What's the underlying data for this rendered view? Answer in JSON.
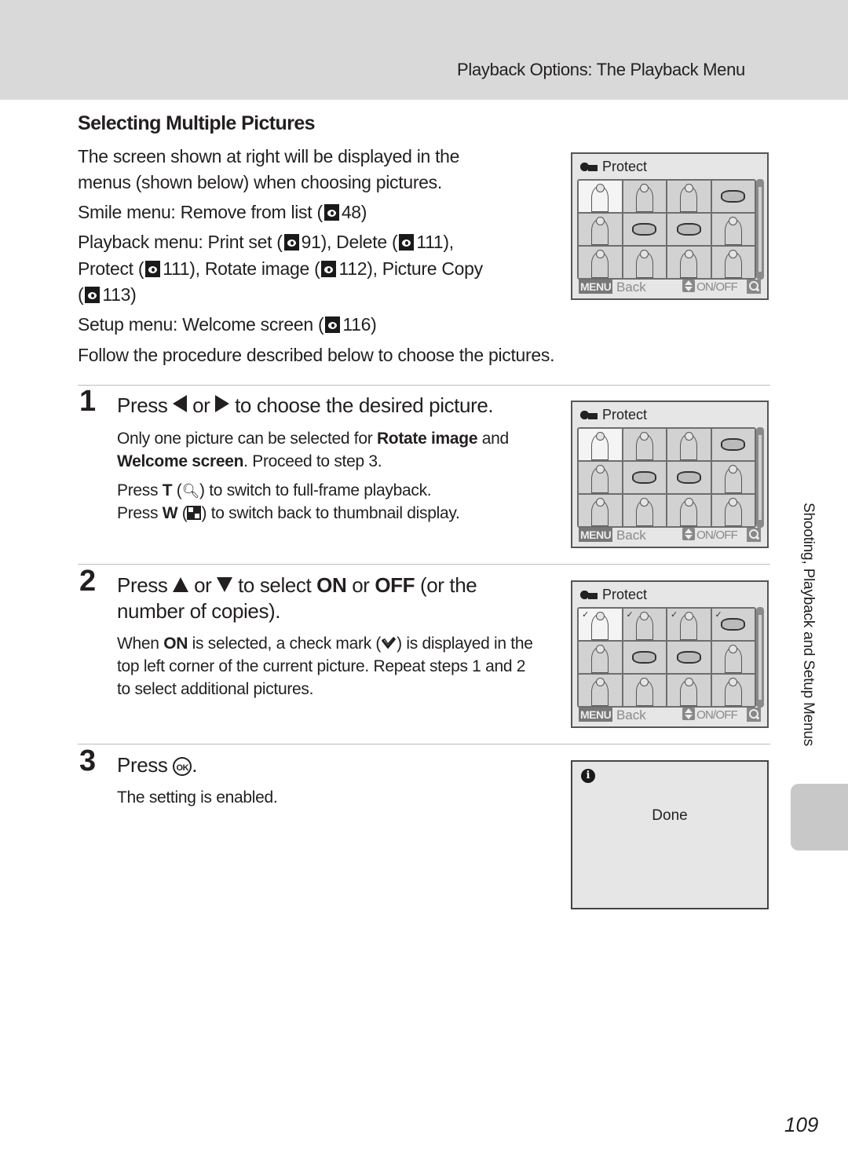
{
  "header": {
    "title": "Playback Options: The Playback Menu"
  },
  "section": {
    "title": "Selecting Multiple Pictures"
  },
  "intro": {
    "line1": "The screen shown at right will be displayed in the",
    "line2": "menus (shown below) when choosing pictures.",
    "smile_prefix": "Smile menu: Remove from list (",
    "smile_ref": "48",
    "smile_suffix": ")",
    "playback_prefix": "Playback menu: Print set (",
    "print_ref": "91",
    "delete_label": "), Delete (",
    "delete_ref": "111",
    "delete_suffix": "),",
    "protect_label": "Protect (",
    "protect_ref": "111",
    "rotate_label": "), Rotate image (",
    "rotate_ref": "112",
    "copy_label": "), Picture Copy",
    "copy_open": "(",
    "copy_ref": "113",
    "copy_suffix": ")",
    "setup_prefix": "Setup menu: Welcome screen (",
    "setup_ref": "116",
    "setup_suffix": ")",
    "follow": "Follow the procedure described below to choose the pictures."
  },
  "steps": [
    {
      "number": "1",
      "head_prefix": "Press",
      "head_or": "or",
      "head_suffix": "to choose the desired picture.",
      "body_a1": "Only one picture can be selected for ",
      "body_a_bold1": "Rotate image",
      "body_a2": " and",
      "body_a_bold2": "Welcome screen",
      "body_a3": ". Proceed to step 3.",
      "body_b_prefix": "Press ",
      "body_b_key": "T",
      "body_b_suffix": ") to switch to full-frame playback.",
      "body_c_prefix": "Press ",
      "body_c_key": "W",
      "body_c_suffix": ") to switch back to thumbnail display."
    },
    {
      "number": "2",
      "head_prefix": "Press",
      "head_or": "or",
      "head_mid": "to select ",
      "head_on": "ON",
      "head_or2": " or ",
      "head_off": "OFF",
      "head_suffix": " (or the",
      "head_line2": "number of copies).",
      "body_1a": "When ",
      "body_1_on": "ON",
      "body_1b": " is selected, a check mark (",
      "body_1c": ") is displayed in the",
      "body_2": "top left corner of the current picture. Repeat steps 1 and 2",
      "body_3": "to select additional pictures."
    },
    {
      "number": "3",
      "head_prefix": "Press",
      "ok_label": "OK",
      "head_suffix": ".",
      "body": "The setting is enabled."
    }
  ],
  "camera_screen": {
    "title": "Protect",
    "menu_badge": "MENU",
    "back_label": "Back",
    "onoff_label": "ON/OFF"
  },
  "done_screen": {
    "message": "Done"
  },
  "side_label": "Shooting, Playback and Setup Menus",
  "page_number": "109"
}
